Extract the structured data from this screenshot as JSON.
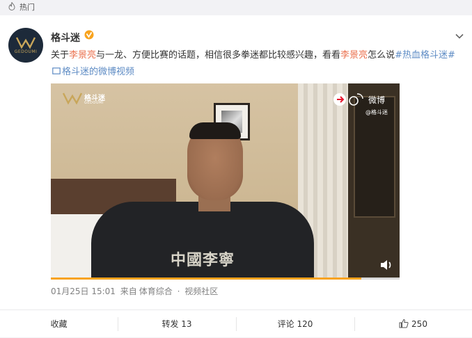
{
  "topbar": {
    "label": "热门",
    "icon": "fire-icon"
  },
  "post": {
    "avatar": {
      "brand_text": "GEDOUMI"
    },
    "username": "格斗迷",
    "verified_icon": "verified-badge-icon",
    "text": {
      "p1": "关于",
      "name1": "李景亮",
      "p2": "与一龙、方便比赛的话题，相信很多拳迷都比较感兴趣，看看",
      "name2": "李景亮",
      "p3": "怎么说",
      "hashtag": "#热血格斗迷#",
      "video_link": "格斗迷的微博视频"
    },
    "video": {
      "watermark_name": "格斗迷",
      "watermark_en": "GEDOUMI",
      "weibo_label": "微博",
      "handle": "@格斗迷",
      "shirt_text": "中國李寧",
      "progress": 0.89
    },
    "meta": {
      "time": "01月25日 15:01",
      "from": "来自",
      "source": "体育综合",
      "separator": "·",
      "section": "视频社区"
    },
    "actions": {
      "favorite": "收藏",
      "repost": "转发 13",
      "comment": "评论 120",
      "like": "250"
    }
  },
  "colors": {
    "highlight": "#eb7350",
    "link": "#5d8bc4",
    "progress": "#f8a31e",
    "verified": "#f8a31e"
  }
}
